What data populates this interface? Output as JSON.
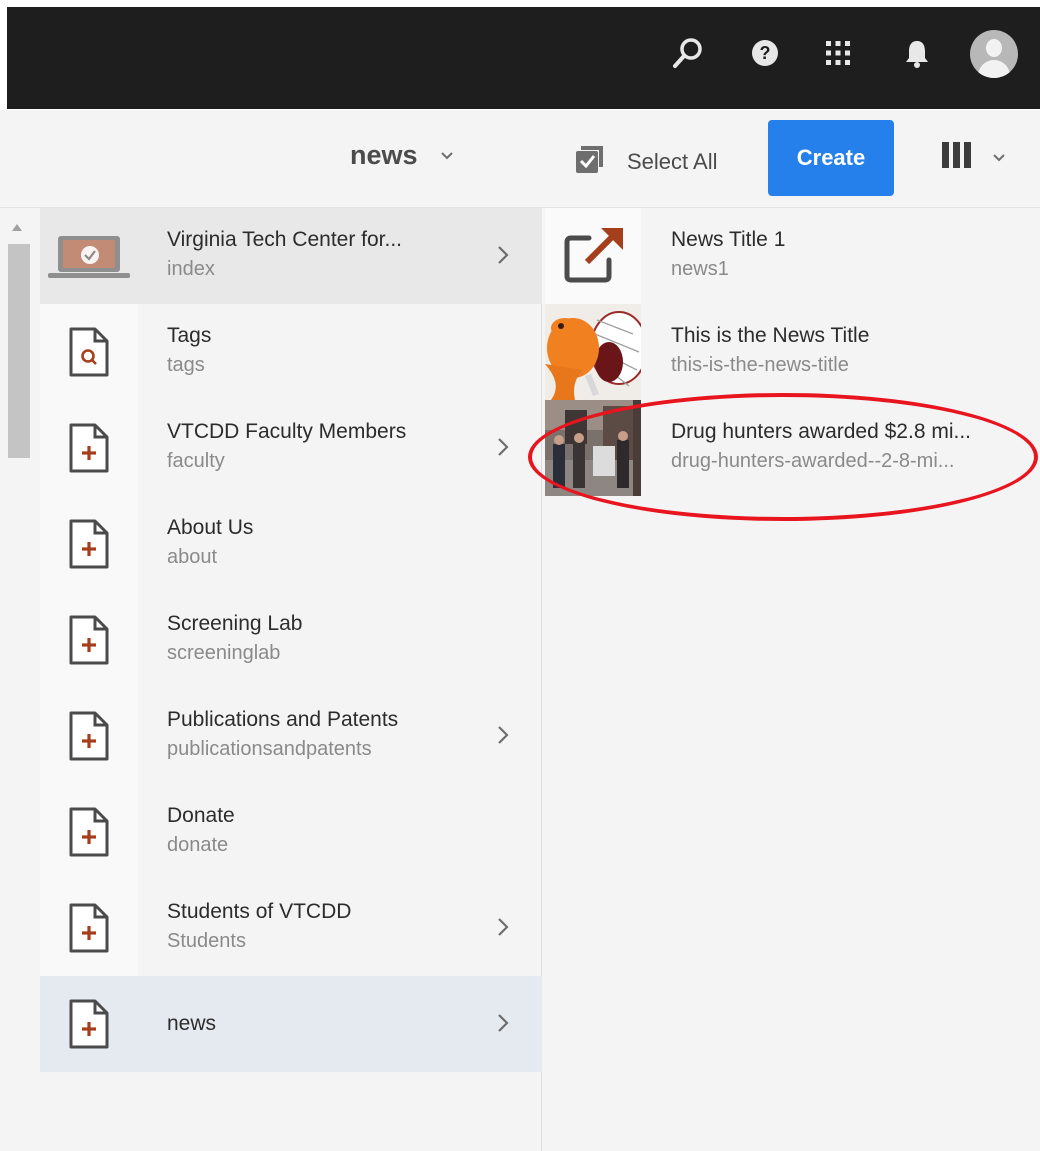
{
  "shell": {
    "icons": [
      "search-icon",
      "help-icon",
      "apps-grid-icon",
      "notifications-bell-icon",
      "user-avatar"
    ]
  },
  "action_bar": {
    "title": "news",
    "select_all_label": "Select All",
    "create_label": "Create",
    "view_icon": "column-view-icon"
  },
  "colors": {
    "accent": "#2680eb",
    "page_icon": "#a53e1a",
    "highlight_ring": "#e8141e"
  },
  "columns": [
    {
      "items": [
        {
          "title": "Virginia Tech Center for...",
          "name": "index",
          "icon": "site-thumbnail-icon",
          "has_children": true,
          "state": "selected-parent"
        },
        {
          "title": "Tags",
          "name": "tags",
          "icon": "search-page-icon",
          "has_children": false
        },
        {
          "title": "VTCDD Faculty Members",
          "name": "faculty",
          "icon": "page-icon",
          "has_children": true
        },
        {
          "title": "About Us",
          "name": "about",
          "icon": "page-icon",
          "has_children": false
        },
        {
          "title": "Screening Lab",
          "name": "screeninglab",
          "icon": "page-icon",
          "has_children": false
        },
        {
          "title": "Publications and Patents",
          "name": "publicationsandpatents",
          "icon": "page-icon",
          "has_children": true
        },
        {
          "title": "Donate",
          "name": "donate",
          "icon": "page-icon",
          "has_children": false
        },
        {
          "title": "Students of VTCDD",
          "name": "Students",
          "icon": "page-icon",
          "has_children": true
        },
        {
          "title": "news",
          "name": "",
          "icon": "page-icon",
          "has_children": true,
          "state": "active"
        }
      ]
    },
    {
      "items": [
        {
          "title": "News Title 1",
          "name": "news1",
          "icon": "external-link-icon"
        },
        {
          "title": "This is the News Title",
          "name": "this-is-the-news-title",
          "icon": "mascot-thumbnail"
        },
        {
          "title": "Drug hunters awarded $2.8 mi...",
          "name": "drug-hunters-awarded--2-8-mi...",
          "icon": "photo-thumbnail",
          "annotated": true
        }
      ]
    }
  ]
}
